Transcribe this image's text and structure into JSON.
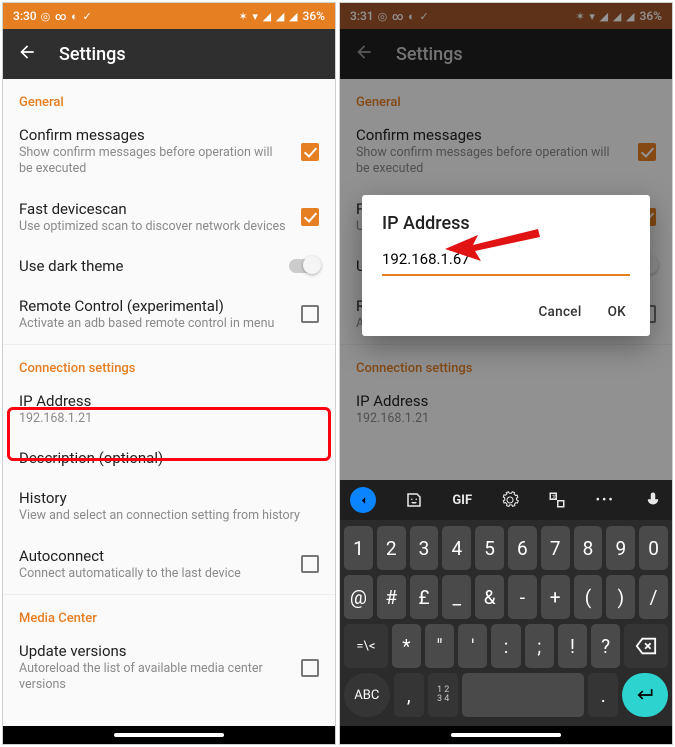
{
  "phone1": {
    "status": {
      "time": "3:30",
      "battery": "36%"
    },
    "appbar": {
      "title": "Settings"
    },
    "sections": {
      "general": "General",
      "connection": "Connection settings",
      "media": "Media Center"
    },
    "rows": {
      "confirm": {
        "title": "Confirm messages",
        "sub": "Show confirm messages before operation will be executed"
      },
      "fastscan": {
        "title": "Fast devicescan",
        "sub": "Use optimized scan to discover network devices"
      },
      "dark": {
        "title": "Use dark theme"
      },
      "remote": {
        "title": "Remote Control (experimental)",
        "sub": "Activate an adb based remote control in menu"
      },
      "ip": {
        "title": "IP Address",
        "sub": "192.168.1.21"
      },
      "desc": {
        "title": "Description (optional)"
      },
      "history": {
        "title": "History",
        "sub": "View and select an connection setting from history"
      },
      "autoconn": {
        "title": "Autoconnect",
        "sub": "Connect automatically to the last device"
      },
      "update": {
        "title": "Update versions",
        "sub": "Autoreload the list of available media center versions"
      }
    }
  },
  "phone2": {
    "status": {
      "time": "3:31",
      "battery": "36%"
    },
    "appbar": {
      "title": "Settings"
    },
    "dialog": {
      "title": "IP Address",
      "value": "192.168.1.67",
      "cancel": "Cancel",
      "ok": "OK"
    },
    "keyboard": {
      "gif": "GIF",
      "row1": [
        "1",
        "2",
        "3",
        "4",
        "5",
        "6",
        "7",
        "8",
        "9",
        "0"
      ],
      "row2": [
        "@",
        "#",
        "£",
        "_",
        "&",
        "-",
        "+",
        "(",
        ")",
        "/"
      ],
      "row3_left": "=\\<",
      "row3": [
        "*",
        "\"",
        "'",
        ":",
        ";",
        "!",
        "?"
      ],
      "row4": {
        "abc": "ABC",
        "comma": ",",
        "nums": [
          "1 2",
          "3 4"
        ],
        "dot": "."
      }
    }
  }
}
